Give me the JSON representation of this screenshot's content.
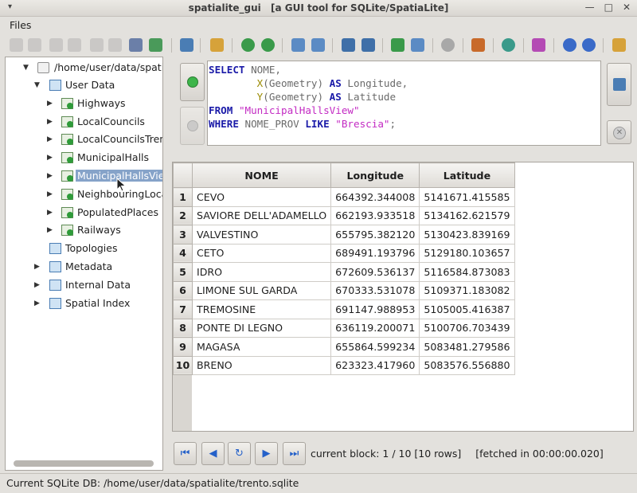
{
  "window": {
    "title_app": "spatialite_gui",
    "title_desc": "[a GUI tool for SQLite/SpatiaLite]",
    "wm_menu_glyph": "▾",
    "min_glyph": "—",
    "max_glyph": "□",
    "close_glyph": "✕"
  },
  "menubar": {
    "files_label": "Files"
  },
  "tree": {
    "root_label": "/home/user/data/spatialite",
    "user_data_label": "User Data",
    "layers": [
      {
        "label": "Highways"
      },
      {
        "label": "LocalCouncils"
      },
      {
        "label": "LocalCouncilsTrento"
      },
      {
        "label": "MunicipalHalls"
      },
      {
        "label": "MunicipalHallsView"
      },
      {
        "label": "NeighbouringLocalities"
      },
      {
        "label": "PopulatedPlaces"
      },
      {
        "label": "Railways"
      }
    ],
    "topologies_label": "Topologies",
    "metadata_label": "Metadata",
    "internal_label": "Internal Data",
    "spatial_index_label": "Spatial Index"
  },
  "sql": {
    "line1_kw": "SELECT",
    "line1_rest": " NOME,",
    "line2_fn": "X",
    "line2_mid": "(Geometry) ",
    "line2_kw": "AS",
    "line2_rest": " Longitude,",
    "line3_fn": "Y",
    "line3_mid": "(Geometry) ",
    "line3_kw": "AS",
    "line3_rest": " Latitude",
    "line4_kw": "FROM",
    "line4_str": "\"MunicipalHallsView\"",
    "line5_kw1": "WHERE",
    "line5_mid": " NOME_PROV ",
    "line5_kw2": "LIKE",
    "line5_str": "\"Brescia\"",
    "line5_end": ";"
  },
  "grid": {
    "columns": [
      "NOME",
      "Longitude",
      "Latitude"
    ],
    "rows": [
      {
        "n": "1",
        "nome": "CEVO",
        "lon": "664392.344008",
        "lat": "5141671.415585"
      },
      {
        "n": "2",
        "nome": "SAVIORE DELL'ADAMELLO",
        "lon": "662193.933518",
        "lat": "5134162.621579"
      },
      {
        "n": "3",
        "nome": "VALVESTINO",
        "lon": "655795.382120",
        "lat": "5130423.839169"
      },
      {
        "n": "4",
        "nome": "CETO",
        "lon": "689491.193796",
        "lat": "5129180.103657"
      },
      {
        "n": "5",
        "nome": "IDRO",
        "lon": "672609.536137",
        "lat": "5116584.873083"
      },
      {
        "n": "6",
        "nome": "LIMONE SUL GARDA",
        "lon": "670333.531078",
        "lat": "5109371.183082"
      },
      {
        "n": "7",
        "nome": "TREMOSINE",
        "lon": "691147.988953",
        "lat": "5105005.416387"
      },
      {
        "n": "8",
        "nome": "PONTE DI LEGNO",
        "lon": "636119.200071",
        "lat": "5100706.703439"
      },
      {
        "n": "9",
        "nome": "MAGASA",
        "lon": "655864.599234",
        "lat": "5083481.279586"
      },
      {
        "n": "10",
        "nome": "BRENO",
        "lon": "623323.417960",
        "lat": "5083576.556880"
      }
    ]
  },
  "nav": {
    "first_glyph": "⏮",
    "prev_glyph": "◀",
    "refresh_glyph": "↻",
    "next_glyph": "▶",
    "last_glyph": "⏭",
    "block_text": "current block: 1 / 10 [10 rows]",
    "fetch_text": "[fetched in 00:00:00.020]"
  },
  "status": {
    "text": "Current SQLite DB: /home/user/data/spatialite/trento.sqlite"
  },
  "colors": {
    "accent": "#86a3c9",
    "keyword": "#1a1aa8",
    "string": "#c32ac3",
    "function": "#9a8a00"
  }
}
